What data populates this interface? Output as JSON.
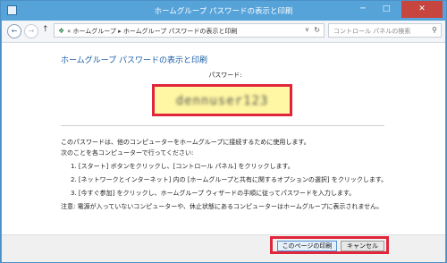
{
  "window": {
    "title": "ホームグループ パスワードの表示と印刷",
    "minimize_glyph": "─",
    "maximize_glyph": "□",
    "close_glyph": "✕"
  },
  "nav": {
    "back_glyph": "←",
    "forward_glyph": "→",
    "up_glyph": "↑",
    "breadcrumb": "« ホームグループ ▸ ホームグループ パスワードの表示と印刷",
    "dropdown_glyph": "∨",
    "refresh_glyph": "↻",
    "search_placeholder": "コントロール パネルの検索",
    "search_glyph": "⚲"
  },
  "main": {
    "heading": "ホームグループ パスワードの表示と印刷",
    "password_label": "パスワード:",
    "password_value": "dennuser123",
    "intro": "このパスワードは、他のコンピューターをホームグループに接続するために使用します。",
    "intro2": "次のことを各コンピューターで行ってください:",
    "steps": [
      "1. [スタート] ボタンをクリックし、[コントロール パネル] をクリックします。",
      "2. [ネットワークとインターネット] 内の [ホームグループと共有に関するオプションの選択] をクリックします。",
      "3. [今すぐ参加] をクリックし、ホームグループ ウィザードの手順に従ってパスワードを入力します。"
    ],
    "note": "注意: 電源が入っていないコンピューターや、休止状態にあるコンピューターはホームグループに表示されません。"
  },
  "footer": {
    "print_label": "このページの印刷",
    "cancel_label": "キャンセル"
  }
}
